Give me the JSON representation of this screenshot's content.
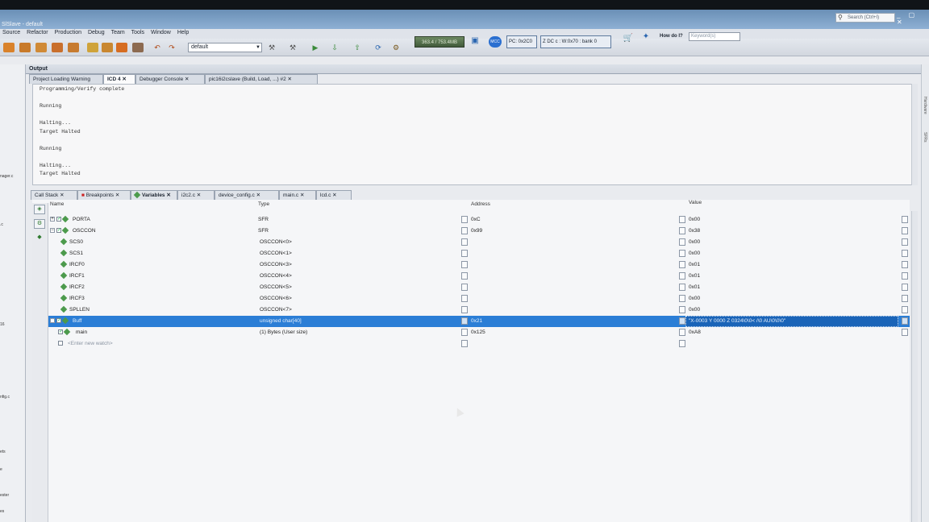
{
  "window": {
    "title": "SlSlave - default",
    "search_placeholder": "Search (Ctrl+I)",
    "controls": "_ ▢ ✕"
  },
  "menu": [
    "Source",
    "Refactor",
    "Production",
    "Debug",
    "Team",
    "Tools",
    "Window",
    "Help"
  ],
  "toolbar": {
    "config_combo": "default",
    "memory": "363.4 / 753.4MB",
    "mcc_label": "MCC",
    "pc_status": "PC: 0x2C0",
    "reg_status": "Z DC c  : W:0x70 : bank 0",
    "howdoi_label": "How do I?",
    "keyword_placeholder": "Keyword(s)"
  },
  "left_panel": [
    "nager.c",
    ".c",
    "16",
    "nfig.c",
    "ets",
    "e",
    "ester",
    "es"
  ],
  "right_strip": [
    "Hardware",
    "SFRs"
  ],
  "output": {
    "header": "Output",
    "tabs": [
      "Project Loading Warning",
      "ICD 4",
      "Debugger Console",
      "pic16i2cslave (Build, Load, ...) #2"
    ],
    "lines": [
      "Programming/Verify complete",
      "",
      "Running",
      "",
      "Halting...",
      "Target Halted",
      "",
      "Running",
      "",
      "Halting...",
      "Target Halted"
    ]
  },
  "bottom_tabs": [
    "Call Stack",
    "Breakpoints",
    "Variables",
    "i2c2.c",
    "device_config.c",
    "main.c",
    "lcd.c"
  ],
  "watches": {
    "columns": {
      "name": "Name",
      "type": "Type",
      "address": "Address",
      "value": "Value"
    },
    "rows": [
      {
        "name": "PORTA",
        "type": "SFR",
        "address": "0xC",
        "value": "0x00"
      },
      {
        "name": "OSCCON",
        "type": "SFR",
        "address": "0x99",
        "value": "0x38"
      },
      {
        "name": "SCS0",
        "type": "OSCCON<0>",
        "address": "",
        "value": "0x00"
      },
      {
        "name": "SCS1",
        "type": "OSCCON<1>",
        "address": "",
        "value": "0x00"
      },
      {
        "name": "IRCF0",
        "type": "OSCCON<3>",
        "address": "",
        "value": "0x01"
      },
      {
        "name": "IRCF1",
        "type": "OSCCON<4>",
        "address": "",
        "value": "0x01"
      },
      {
        "name": "IRCF2",
        "type": "OSCCON<5>",
        "address": "",
        "value": "0x01"
      },
      {
        "name": "IRCF3",
        "type": "OSCCON<6>",
        "address": "",
        "value": "0x00"
      },
      {
        "name": "SPLLEN",
        "type": "OSCCON<7>",
        "address": "",
        "value": "0x00"
      },
      {
        "name": "Buff",
        "type": "unsigned char[40]",
        "address": "0x21",
        "value": "\"X-0003  Y 0000      Z 0324\\0\\0<  /\\0    AU\\0\\0\\0\""
      },
      {
        "name": "main",
        "type": "(1) Bytes (User size)",
        "address": "0x125",
        "value": "0xA8"
      }
    ],
    "new_watch_placeholder": "<Enter new watch>"
  }
}
